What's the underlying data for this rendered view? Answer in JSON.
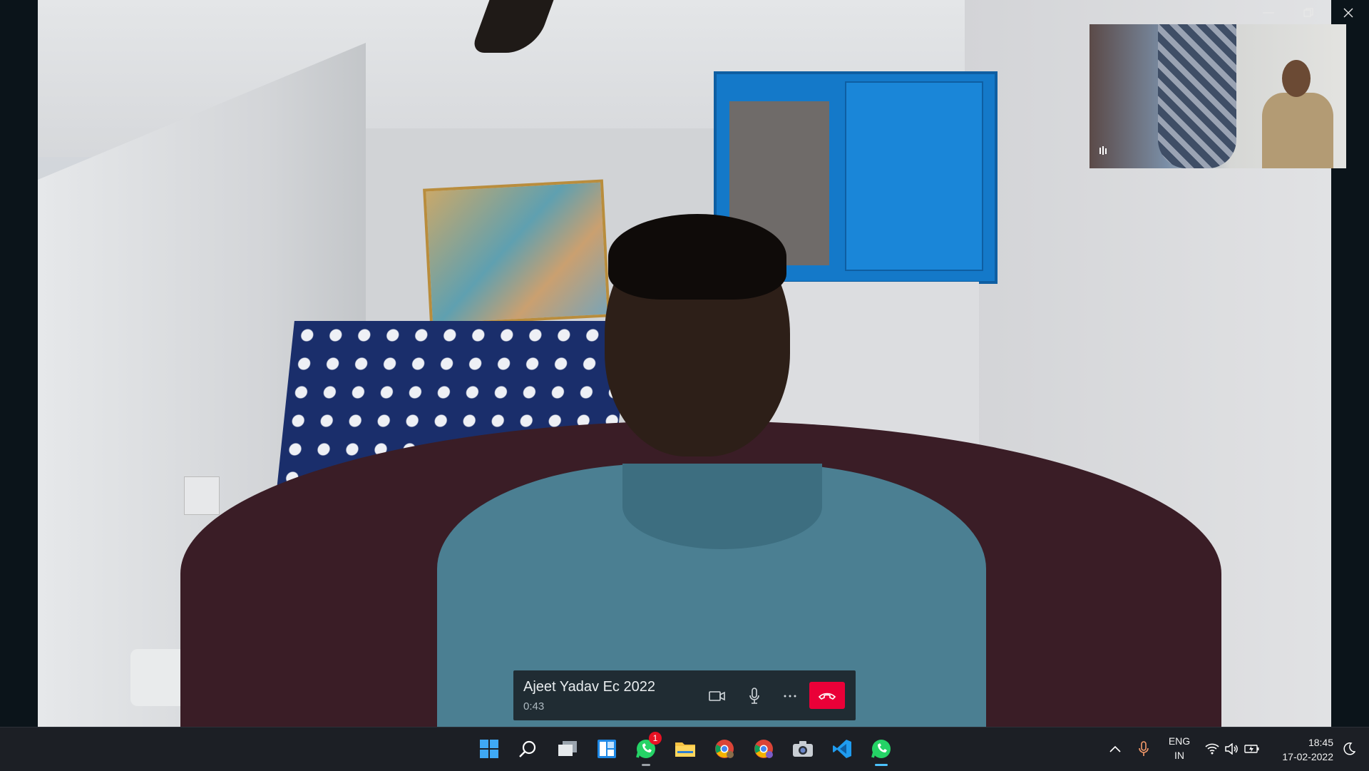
{
  "call": {
    "caller_name": "Ajeet Yadav Ec 2022",
    "duration": "0:43"
  },
  "tray": {
    "language_line1": "ENG",
    "language_line2": "IN",
    "time": "18:45",
    "date": "17-02-2022"
  },
  "taskbar": {
    "whatsapp_badge": "1"
  },
  "colors": {
    "end_call": "#ea0038",
    "taskbar": "#1c1f25",
    "callbar": "#202c33"
  }
}
